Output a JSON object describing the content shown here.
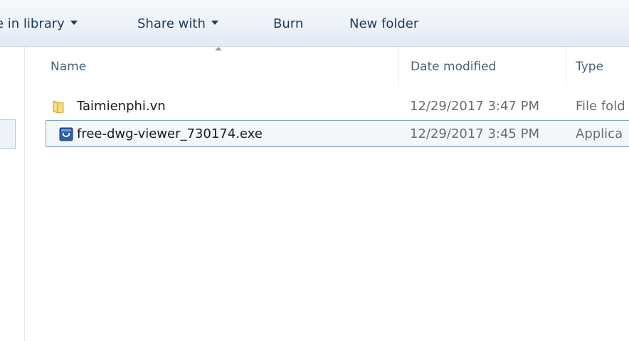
{
  "toolbar": {
    "include_in_library": "e in library",
    "share_with": "Share with",
    "burn": "Burn",
    "new_folder": "New folder"
  },
  "columns": {
    "name": "Name",
    "date_modified": "Date modified",
    "type": "Type"
  },
  "files": [
    {
      "name": "Taimienphi.vn",
      "date_modified": "12/29/2017 3:47 PM",
      "type": "File fold",
      "icon": "folder-icon"
    },
    {
      "name": "free-dwg-viewer_730174.exe",
      "date_modified": "12/29/2017 3:45 PM",
      "type": "Applica",
      "icon": "application-icon",
      "selected": true
    }
  ],
  "colors": {
    "toolbar_text": "#1e395b",
    "header_text": "#4c607a",
    "selection_border": "#7da2ce",
    "folder_yellow": "#f2c84b",
    "app_icon_blue": "#2a5ea8"
  }
}
